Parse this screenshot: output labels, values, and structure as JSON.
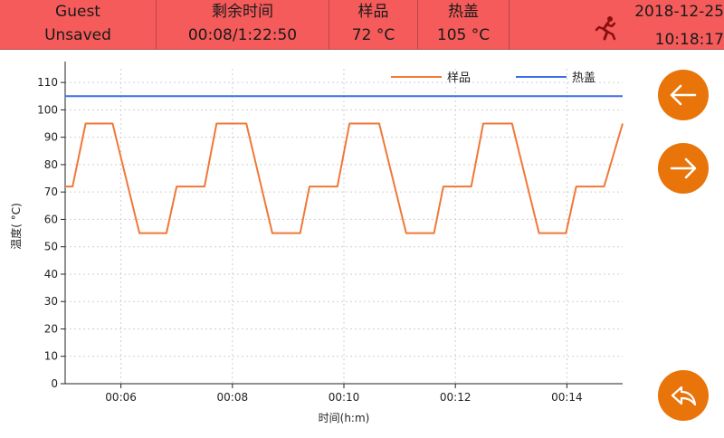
{
  "header": {
    "user": "Guest",
    "save_status": "Unsaved",
    "remaining_label": "剩余时间",
    "remaining_value": "00:08/1:22:50",
    "sample_label": "样品",
    "sample_value": "72 °C",
    "lid_label": "热盖",
    "lid_value": "105 °C",
    "date": "2018-12-25",
    "time": "10:18:17",
    "status_icon": "running-person-icon"
  },
  "nav": {
    "prev_icon": "arrow-left-icon",
    "next_icon": "arrow-right-icon",
    "back_icon": "return-icon"
  },
  "colors": {
    "header_bg": "#f55b5b",
    "accent": "#e8740a",
    "sample_line": "#f07838",
    "lid_line": "#3a6fe8"
  },
  "chart_data": {
    "type": "line",
    "xlabel": "时间(h:m)",
    "ylabel": "温度( °C)",
    "xlim": [
      "00:05:00",
      "00:15:00"
    ],
    "ylim": [
      0,
      115
    ],
    "x_ticks": [
      "00:06",
      "00:08",
      "00:10",
      "00:12",
      "00:14"
    ],
    "y_ticks": [
      0,
      10,
      20,
      30,
      40,
      50,
      60,
      70,
      80,
      90,
      100,
      110
    ],
    "grid": true,
    "legend_position": "top-right",
    "series": [
      {
        "name": "样品",
        "color": "#f07838",
        "points": [
          [
            "00:05:00",
            72
          ],
          [
            "00:05:08",
            72
          ],
          [
            "00:05:22",
            95
          ],
          [
            "00:05:51",
            95
          ],
          [
            "00:06:20",
            55
          ],
          [
            "00:06:49",
            55
          ],
          [
            "00:07:00",
            72
          ],
          [
            "00:07:30",
            72
          ],
          [
            "00:07:43",
            95
          ],
          [
            "00:08:15",
            95
          ],
          [
            "00:08:43",
            55
          ],
          [
            "00:09:13",
            55
          ],
          [
            "00:09:23",
            72
          ],
          [
            "00:09:53",
            72
          ],
          [
            "00:10:06",
            95
          ],
          [
            "00:10:38",
            95
          ],
          [
            "00:11:07",
            55
          ],
          [
            "00:11:37",
            55
          ],
          [
            "00:11:47",
            72
          ],
          [
            "00:12:17",
            72
          ],
          [
            "00:12:30",
            95
          ],
          [
            "00:13:01",
            95
          ],
          [
            "00:13:30",
            55
          ],
          [
            "00:13:59",
            55
          ],
          [
            "00:14:10",
            72
          ],
          [
            "00:14:40",
            72
          ],
          [
            "00:15:00",
            95
          ]
        ]
      },
      {
        "name": "热盖",
        "color": "#3a6fe8",
        "points": [
          [
            "00:05:00",
            105
          ],
          [
            "00:15:00",
            105
          ]
        ]
      }
    ]
  }
}
